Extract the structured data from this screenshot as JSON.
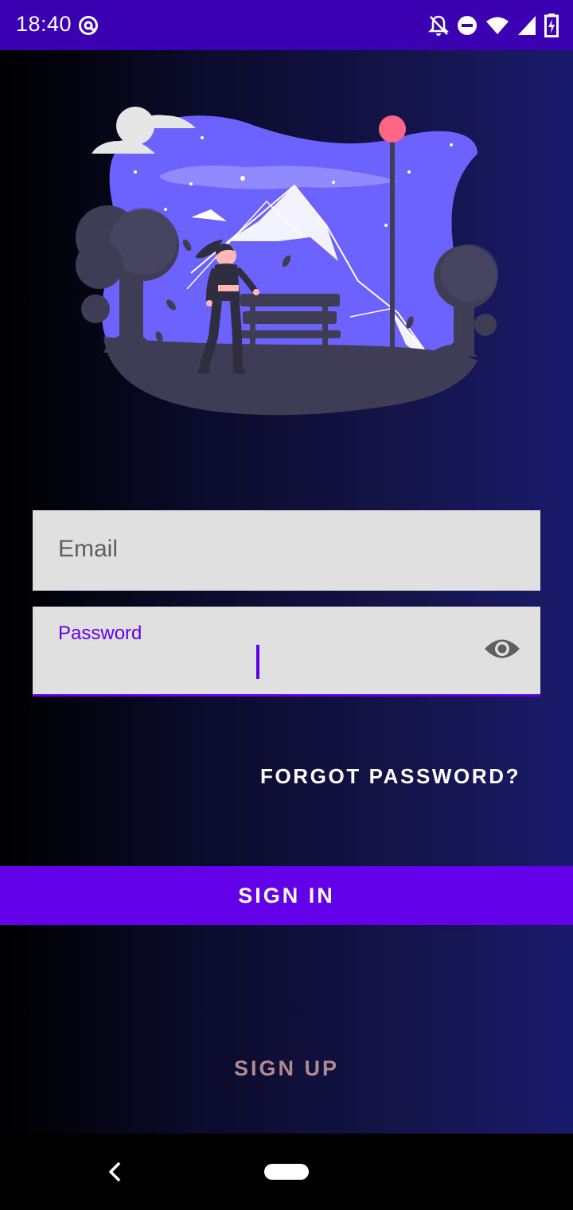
{
  "status_bar": {
    "time": "18:40",
    "left_icons": [
      "at-sign-icon"
    ],
    "right_icons": [
      "notifications-off-icon",
      "do-not-disturb-icon",
      "wifi-icon",
      "signal-icon",
      "battery-charging-icon"
    ]
  },
  "illustration": {
    "icon": "park-night-illustration"
  },
  "form": {
    "email_label": "Email",
    "password_label": "Password",
    "password_value": "",
    "password_toggle_icon": "eye-icon"
  },
  "actions": {
    "forgot_password": "FORGOT PASSWORD?",
    "sign_in": "SIGN IN",
    "sign_up": "SIGN UP"
  },
  "nav_bar": {
    "back_icon": "back-chevron-icon",
    "home_icon": "home-pill-icon"
  },
  "colors": {
    "status_bar": "#3a00b2",
    "accent": "#6200ea",
    "field_bg": "#e0e0e0",
    "sign_up_text": "#b08a8e",
    "illustration_sky": "#6c63ff",
    "illustration_ground": "#3f3d56",
    "lamp_light": "#ff6584"
  }
}
